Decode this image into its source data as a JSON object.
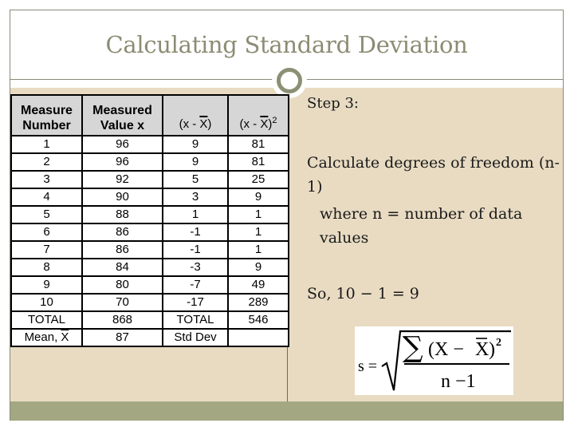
{
  "slide": {
    "title": "Calculating Standard Deviation",
    "colors": {
      "title_text": "#8c8c74",
      "body_background": "#e8dbc2",
      "footer_band": "#a3a883",
      "frame_border": "#8a8a78",
      "table_header_background": "#d6d6d6",
      "ornament_ring": "#8c9074"
    }
  },
  "table": {
    "headers": {
      "measure_number_line1": "Measure",
      "measure_number_line2": "Number",
      "measured_value_line1": "Measured",
      "measured_value_line2": "Value x",
      "deviation_prefix": "(x - ",
      "deviation_symbol": "X",
      "deviation_suffix": ")",
      "squared_prefix": "(x - ",
      "squared_symbol": "X",
      "squared_suffix": ")",
      "squared_exponent": "2"
    },
    "rows": [
      {
        "n": "1",
        "x": "96",
        "dev": "9",
        "sq": "81"
      },
      {
        "n": "2",
        "x": "96",
        "dev": "9",
        "sq": "81"
      },
      {
        "n": "3",
        "x": "92",
        "dev": "5",
        "sq": "25"
      },
      {
        "n": "4",
        "x": "90",
        "dev": "3",
        "sq": "9"
      },
      {
        "n": "5",
        "x": "88",
        "dev": "1",
        "sq": "1"
      },
      {
        "n": "6",
        "x": "86",
        "dev": "-1",
        "sq": "1"
      },
      {
        "n": "7",
        "x": "86",
        "dev": "-1",
        "sq": "1"
      },
      {
        "n": "8",
        "x": "84",
        "dev": "-3",
        "sq": "9"
      },
      {
        "n": "9",
        "x": "80",
        "dev": "-7",
        "sq": "49"
      },
      {
        "n": "10",
        "x": "70",
        "dev": "-17",
        "sq": "289"
      }
    ],
    "total_row": {
      "label": "TOTAL",
      "x_total": "868",
      "label2": "TOTAL",
      "sq_total": "546"
    },
    "mean_row": {
      "label_prefix": "Mean, ",
      "label_symbol": "X",
      "mean_value": "87",
      "label2": "Std Dev",
      "std_dev_value": ""
    }
  },
  "right_panel": {
    "step_label": "Step 3:",
    "instruction": "Calculate degrees of freedom (n-1)",
    "sub_instruction": "where n = number of data values",
    "result": "So, 10 − 1 = 9"
  },
  "formula": {
    "lhs": "s =",
    "numerator_sum": "∑",
    "numerator_open": "(X − ",
    "numerator_xbar": "X",
    "numerator_close": ")",
    "numerator_exponent": "2",
    "denominator": "n −1"
  }
}
